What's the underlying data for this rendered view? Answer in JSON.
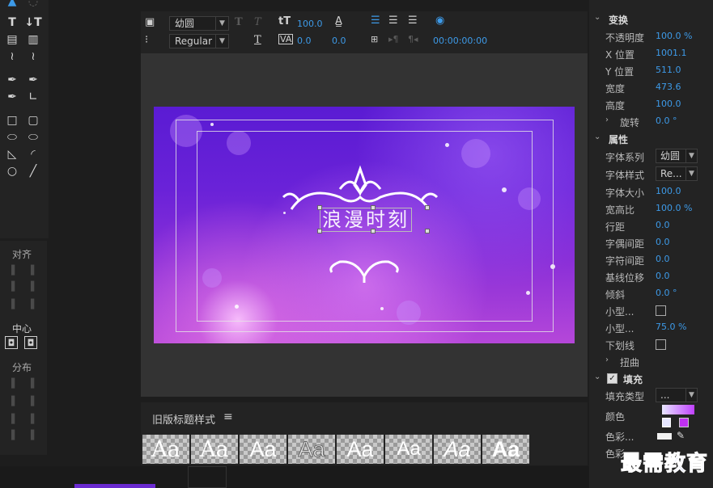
{
  "toolbar": {
    "font_family": "幼圆",
    "font_style": "Regular",
    "font_size": "100.0",
    "kerning": "0.0",
    "leading": "0.0",
    "timecode": "00:00:00:00",
    "icons": [
      "text-box-icon",
      "tab-stops-icon",
      "bold-icon",
      "italic-icon",
      "underline-icon",
      "font-size-icon",
      "kerning-icon",
      "leading-icon",
      "align-left-icon",
      "align-center-icon",
      "align-right-icon",
      "tab-icon",
      "show-video-icon"
    ]
  },
  "canvas": {
    "title_text": "浪漫时刻"
  },
  "align_panel": {
    "align_label": "对齐",
    "center_label": "中心",
    "distribute_label": "分布"
  },
  "styles_panel": {
    "title": "旧版标题样式",
    "menu_icon": "hamburger-icon",
    "swatch_label": "Aa",
    "swatch_count": 8
  },
  "properties": {
    "transform": {
      "header": "变换",
      "opacity_label": "不透明度",
      "opacity": "100.0 %",
      "x_label": "X 位置",
      "x": "1001.1",
      "y_label": "Y 位置",
      "y": "511.0",
      "width_label": "宽度",
      "width": "473.6",
      "height_label": "高度",
      "height": "100.0",
      "rotation_label": "旋转",
      "rotation": "0.0 °"
    },
    "properties_section": {
      "header": "属性",
      "font_family_label": "字体系列",
      "font_family": "幼圆",
      "font_style_label": "字体样式",
      "font_style": "Re...",
      "font_size_label": "字体大小",
      "font_size": "100.0",
      "aspect_label": "宽高比",
      "aspect": "100.0 %",
      "leading_label": "行距",
      "leading": "0.0",
      "kerning_label": "字偶间距",
      "kerning": "0.0",
      "tracking_label": "字符间距",
      "tracking": "0.0",
      "baseline_label": "基线位移",
      "baseline": "0.0",
      "slant_label": "倾斜",
      "slant": "0.0 °",
      "small_caps_label": "小型...",
      "small_caps_size_label": "小型...",
      "small_caps_size": "75.0 %",
      "underline_label": "下划线",
      "distort_label": "扭曲"
    },
    "fill": {
      "header": "填充",
      "fill_type_label": "填充类型",
      "fill_type": "...",
      "color_label": "颜色",
      "color_stop_label": "色彩...",
      "color_stop2_label": "色彩..."
    }
  },
  "colors": {
    "accent_blue": "#3d9ae8",
    "gradient_start": "#e6e6ff",
    "gradient_end": "#c040ff",
    "stop_color": "#c030f0"
  },
  "watermark": "最需教育"
}
